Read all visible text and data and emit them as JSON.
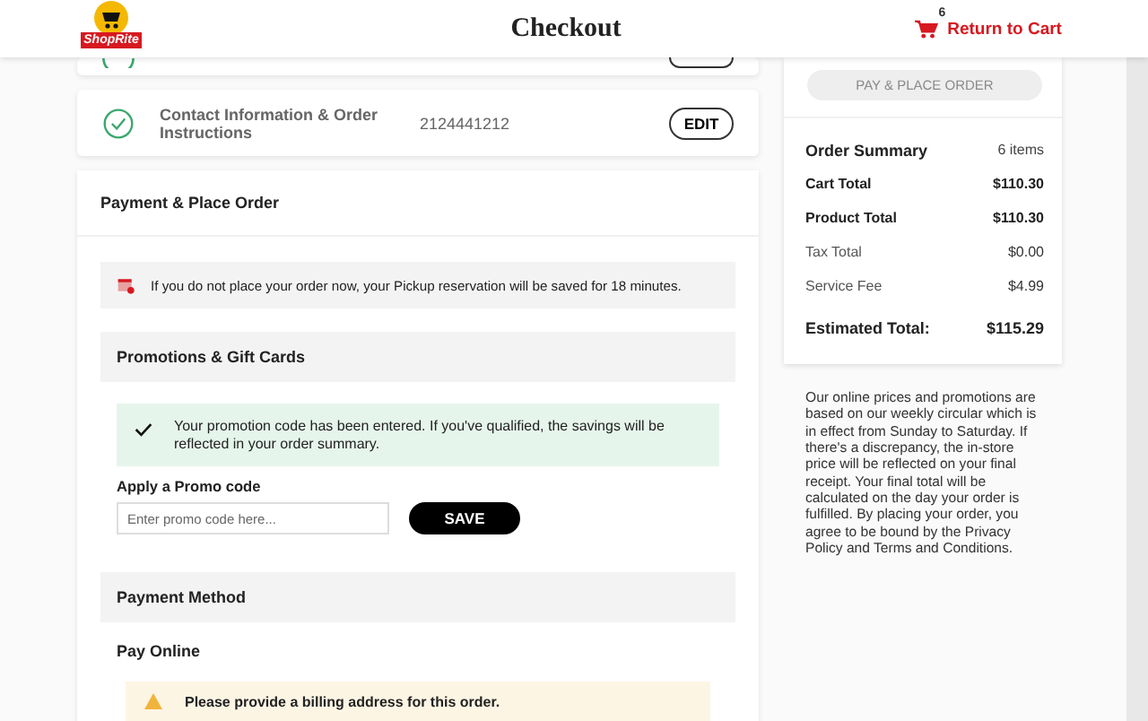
{
  "header": {
    "logo_text": "ShopRite",
    "title": "Checkout",
    "cart_count": "6",
    "return_link": "Return to Cart"
  },
  "steps": [
    {
      "complete": true,
      "cut": true
    },
    {
      "label": "Contact Information & Order Instructions",
      "value": "2124441212",
      "complete": true,
      "cut": false,
      "button": "EDIT"
    }
  ],
  "payment": {
    "title": "Payment & Place Order",
    "reservation_notice": "If you do not place your order now, your Pickup reservation will be saved for 18 minutes.",
    "promotions": {
      "title": "Promotions & Gift Cards",
      "success": "Your promotion code has been entered. If you've qualified, the savings will be reflected in your order summary.",
      "field_label": "Apply a Promo code",
      "placeholder": "Enter promo code here...",
      "button": "SAVE"
    },
    "method": {
      "title": "Payment Method",
      "option": "Pay Online",
      "warning": "Please provide a billing address for this order."
    }
  },
  "summary": {
    "button": "PAY & PLACE ORDER",
    "button_disabled": true,
    "title": "Order Summary",
    "count": "6 items",
    "rows": [
      {
        "label": "Cart Total",
        "value": "$110.30",
        "emphasis": true
      },
      {
        "label": "Product Total",
        "value": "$110.30",
        "emphasis": true
      },
      {
        "label": "Tax Total",
        "value": "$0.00",
        "emphasis": false
      },
      {
        "label": "Service Fee",
        "value": "$4.99",
        "emphasis": false
      }
    ],
    "total_label": "Estimated Total:",
    "total_value": "$115.29"
  },
  "disclaimer": "Our online prices and promotions are based on our weekly circular which is in effect from Sunday to Saturday. If there's a discrepancy, the in-store price will be reflected on your final receipt. Your final total will be calculated on the day your order is fulfilled. By placing your order, you agree to be bound by the Privacy Policy and Terms and Conditions."
}
